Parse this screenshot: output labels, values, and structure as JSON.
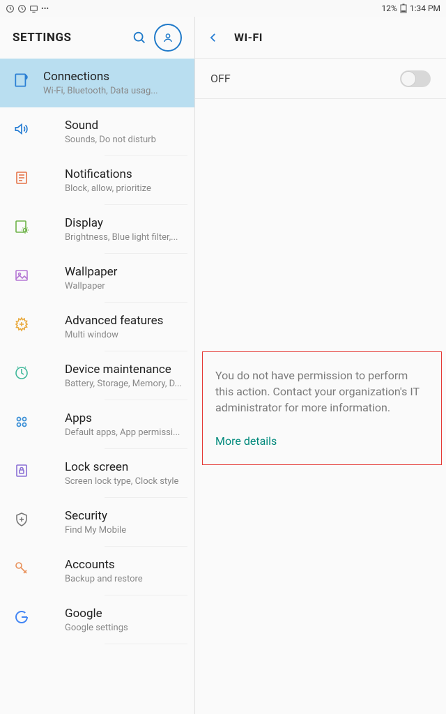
{
  "status": {
    "battery": "12%",
    "time": "1:34 PM"
  },
  "leftHeader": {
    "title": "SETTINGS"
  },
  "settings": [
    {
      "title": "Connections",
      "sub": "Wi-Fi, Bluetooth, Data usag..."
    },
    {
      "title": "Sound",
      "sub": "Sounds, Do not disturb"
    },
    {
      "title": "Notifications",
      "sub": "Block, allow, prioritize"
    },
    {
      "title": "Display",
      "sub": "Brightness, Blue light filter,..."
    },
    {
      "title": "Wallpaper",
      "sub": "Wallpaper"
    },
    {
      "title": "Advanced features",
      "sub": "Multi window"
    },
    {
      "title": "Device maintenance",
      "sub": "Battery, Storage, Memory, D..."
    },
    {
      "title": "Apps",
      "sub": "Default apps, App permissi..."
    },
    {
      "title": "Lock screen",
      "sub": "Screen lock type, Clock style"
    },
    {
      "title": "Security",
      "sub": "Find My Mobile"
    },
    {
      "title": "Accounts",
      "sub": "Backup and restore"
    },
    {
      "title": "Google",
      "sub": "Google settings"
    }
  ],
  "rightHeader": {
    "title": "WI-FI"
  },
  "toggle": {
    "label": "OFF"
  },
  "permission": {
    "message": "You do not have permission to perform this action. Contact your organization's IT administrator for more information.",
    "link": "More details"
  }
}
